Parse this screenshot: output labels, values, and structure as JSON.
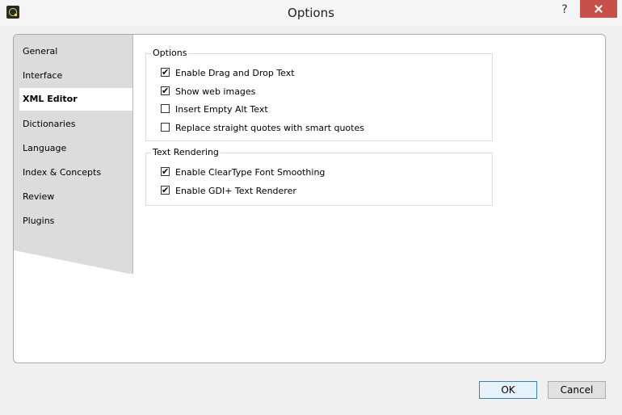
{
  "window": {
    "title": "Options",
    "help": "?"
  },
  "sidebar": {
    "items": [
      {
        "label": "General"
      },
      {
        "label": "Interface"
      },
      {
        "label": "XML Editor",
        "selected": true
      },
      {
        "label": "Dictionaries"
      },
      {
        "label": "Language"
      },
      {
        "label": "Index & Concepts"
      },
      {
        "label": "Review"
      },
      {
        "label": "Plugins"
      }
    ]
  },
  "groups": {
    "options": {
      "title": "Options",
      "items": [
        {
          "label": "Enable Drag and Drop Text",
          "checked": true
        },
        {
          "label": "Show web images",
          "checked": true
        },
        {
          "label": "Insert Empty Alt Text",
          "checked": false
        },
        {
          "label": "Replace straight quotes with smart quotes",
          "checked": false
        }
      ]
    },
    "rendering": {
      "title": "Text Rendering",
      "items": [
        {
          "label": "Enable ClearType Font Smoothing",
          "checked": true
        },
        {
          "label": "Enable GDI+ Text Renderer",
          "checked": true
        }
      ]
    }
  },
  "buttons": {
    "ok": "OK",
    "cancel": "Cancel"
  }
}
